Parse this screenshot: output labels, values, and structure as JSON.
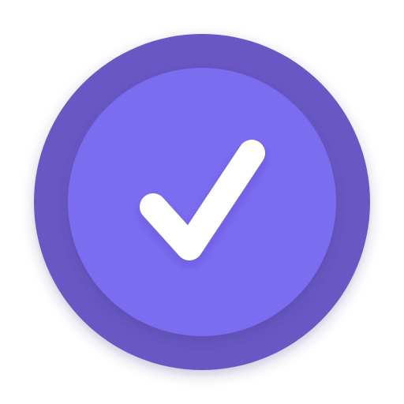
{
  "icon": {
    "name": "check-icon",
    "outer_ring_color": "#6959c4",
    "inner_circle_color": "#7b6cf0",
    "check_color": "#ffffff",
    "shadow_color": "#3f3480"
  }
}
